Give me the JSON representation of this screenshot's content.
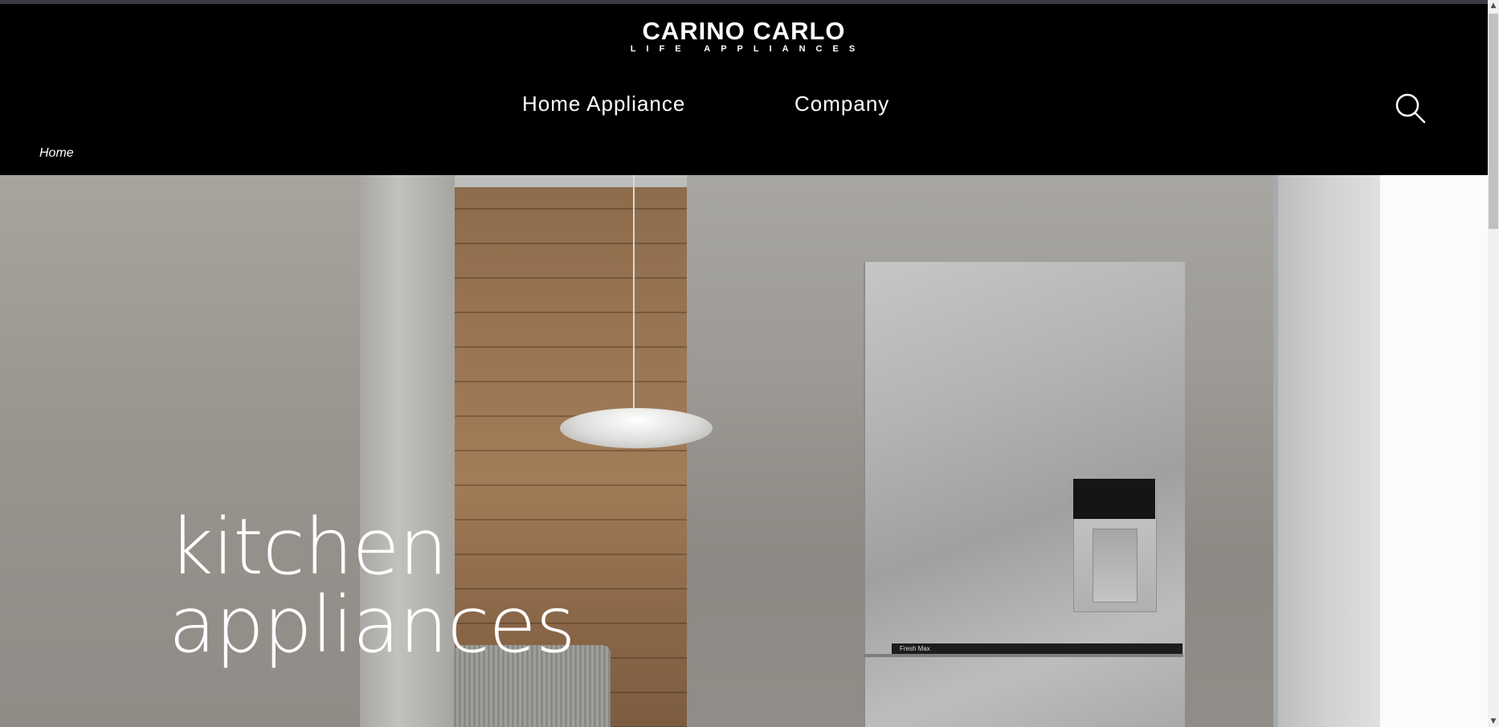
{
  "brand": {
    "name": "CARINO CARLO",
    "tagline": "LIFE APPLIANCES"
  },
  "nav": {
    "items": [
      {
        "label": "Home Appliance"
      },
      {
        "label": "Company"
      }
    ],
    "search_icon": "search-icon"
  },
  "breadcrumb": {
    "current": "Home"
  },
  "hero": {
    "title_line1": "kitchen",
    "title_line2": "appliances",
    "fridge_label": "Fresh Max"
  },
  "colors": {
    "header_bg": "#000000",
    "text": "#ffffff"
  }
}
